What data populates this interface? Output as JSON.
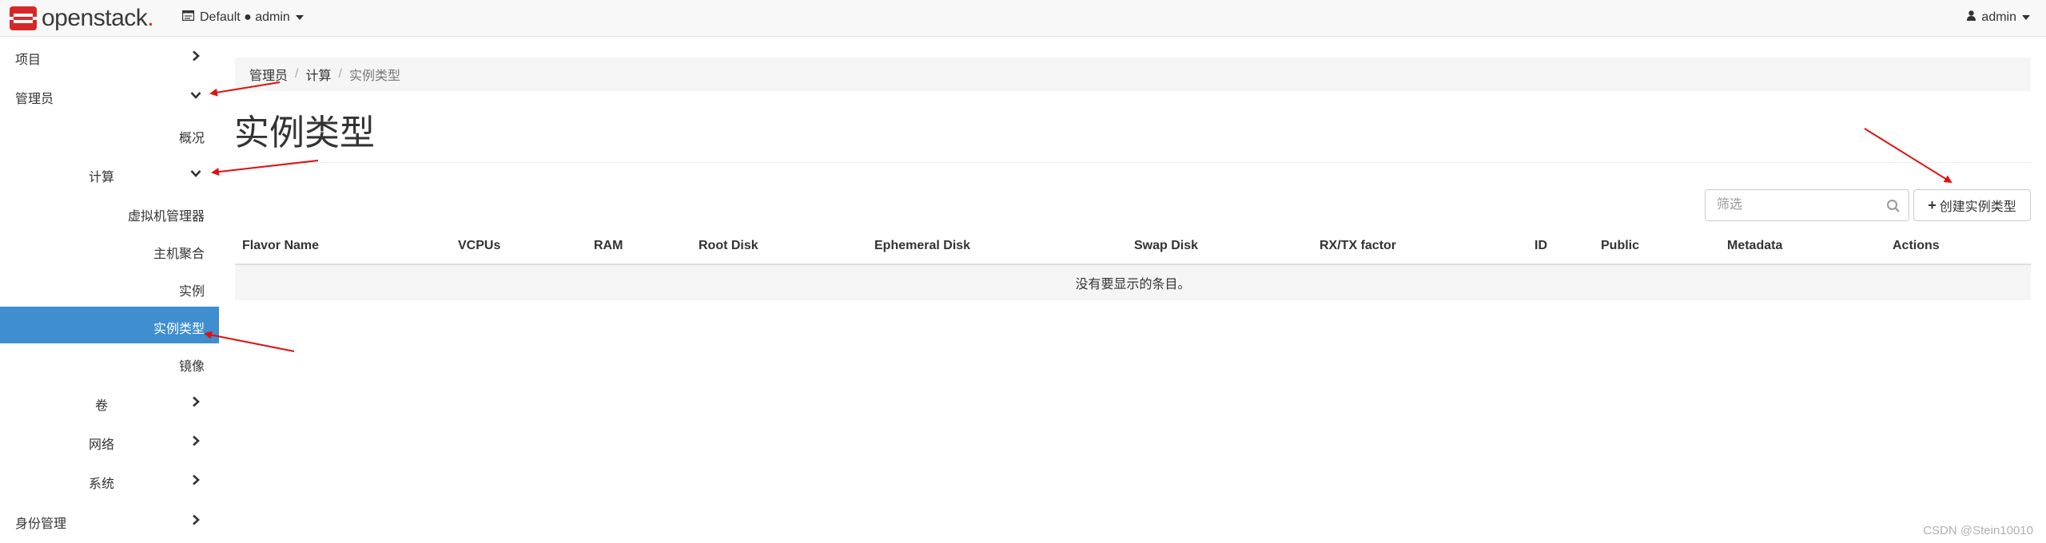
{
  "brand": {
    "name_a": "openstack",
    "name_b": "."
  },
  "topbar": {
    "project": "Default ● admin",
    "user": "admin"
  },
  "sidebar": {
    "items": [
      {
        "label": "项目"
      },
      {
        "label": "管理员"
      },
      {
        "label": "概况"
      },
      {
        "label": "计算"
      },
      {
        "label": "虚拟机管理器"
      },
      {
        "label": "主机聚合"
      },
      {
        "label": "实例"
      },
      {
        "label": "实例类型"
      },
      {
        "label": "镜像"
      },
      {
        "label": "卷"
      },
      {
        "label": "网络"
      },
      {
        "label": "系统"
      },
      {
        "label": "身份管理"
      }
    ]
  },
  "breadcrumb": [
    "管理员",
    "计算",
    "实例类型"
  ],
  "page": {
    "title": "实例类型"
  },
  "filter": {
    "placeholder": "筛选"
  },
  "create_button": "创建实例类型",
  "table": {
    "columns": [
      "Flavor Name",
      "VCPUs",
      "RAM",
      "Root Disk",
      "Ephemeral Disk",
      "Swap Disk",
      "RX/TX factor",
      "ID",
      "Public",
      "Metadata",
      "Actions"
    ],
    "empty_message": "没有要显示的条目。"
  },
  "watermark": "CSDN @Stein10010",
  "colors": {
    "accent": "#3e8ed0",
    "annotation_arrow": "#e01010",
    "brand_red": "#d72828"
  }
}
